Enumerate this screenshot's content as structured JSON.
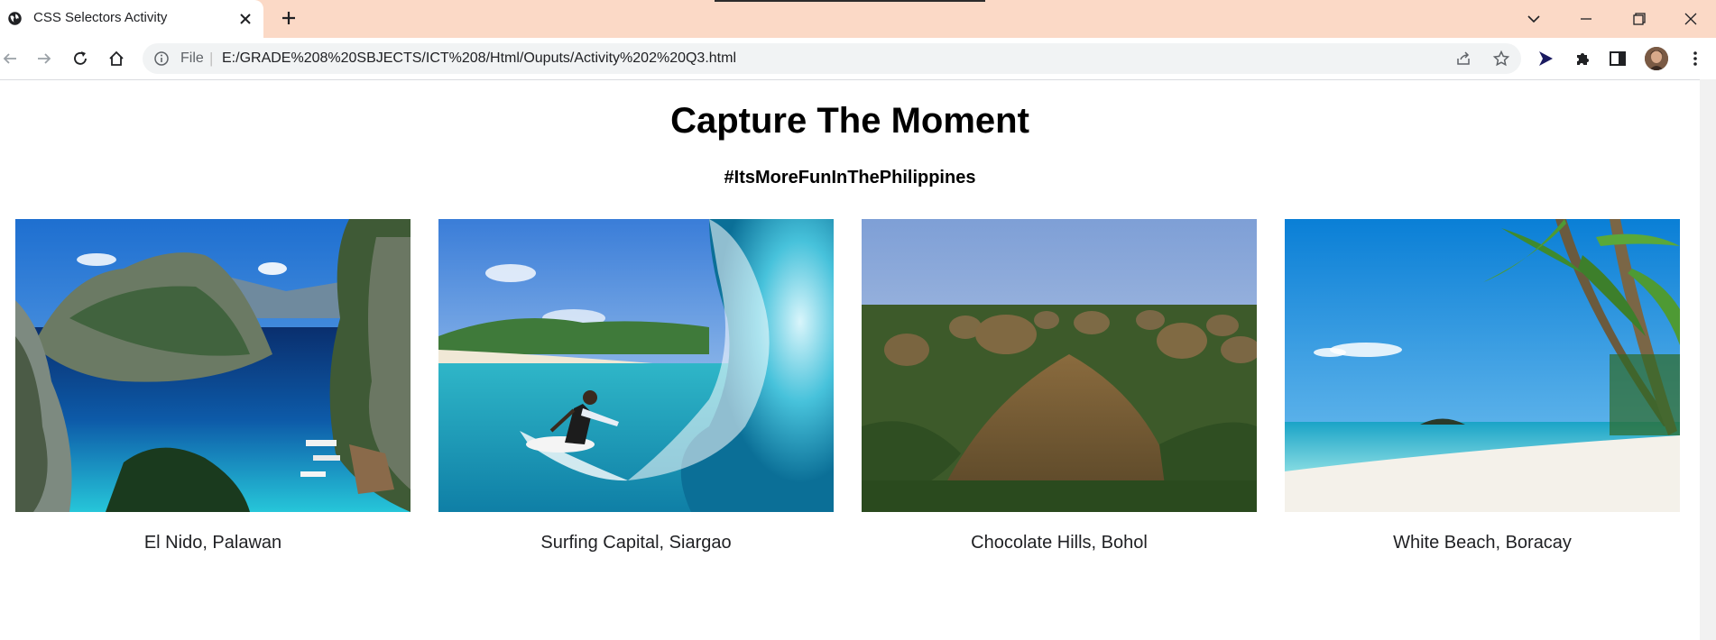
{
  "browser": {
    "tab_title": "CSS Selectors Activity",
    "url_scheme": "File",
    "url": "E:/GRADE%208%20SBJECTS/ICT%208/Html/Ouputs/Activity%202%20Q3.html",
    "tabstrip_color": "#fbd9c6"
  },
  "page": {
    "title": "Capture The Moment",
    "subtitle": "#ItsMoreFunInThePhilippines"
  },
  "gallery": [
    {
      "caption": "El Nido, Palawan"
    },
    {
      "caption": "Surfing Capital, Siargao"
    },
    {
      "caption": "Chocolate Hills, Bohol"
    },
    {
      "caption": "White Beach, Boracay"
    }
  ],
  "icons": [
    "globe-icon",
    "close-icon",
    "plus-icon",
    "chevron-down-icon",
    "minimize-icon",
    "restore-icon",
    "back-icon",
    "forward-icon",
    "reload-icon",
    "home-icon",
    "info-icon",
    "share-icon",
    "star-icon",
    "send-icon",
    "puzzle-icon",
    "sidepanel-icon",
    "kebab-menu-icon"
  ]
}
